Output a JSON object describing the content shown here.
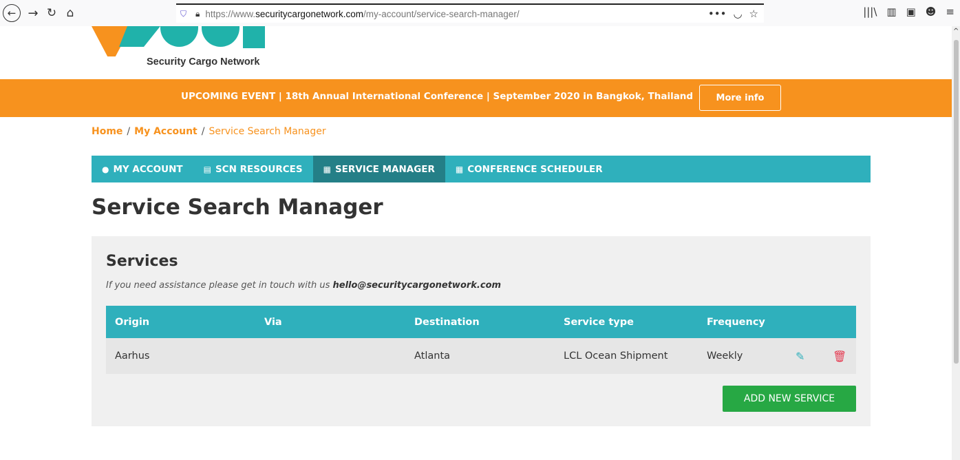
{
  "browser": {
    "url_scheme": "https://www.",
    "url_host": "securitycargonetwork.com",
    "url_path": "/my-account/service-search-manager/"
  },
  "logo": {
    "text": "Security Cargo Network"
  },
  "banner": {
    "text": "UPCOMING EVENT | 18th Annual International Conference | September 2020 in Bangkok, Thailand",
    "button": "More info"
  },
  "breadcrumb": {
    "home": "Home",
    "sep": "/",
    "account": "My Account",
    "current": "Service Search Manager"
  },
  "nav": {
    "tabs": [
      {
        "label": "MY ACCOUNT",
        "icon": "user-circle-icon"
      },
      {
        "label": "SCN RESOURCES",
        "icon": "file-icon"
      },
      {
        "label": "SERVICE MANAGER",
        "icon": "keyboard-icon"
      },
      {
        "label": "CONFERENCE SCHEDULER",
        "icon": "calendar-icon"
      }
    ]
  },
  "page": {
    "title": "Service Search Manager"
  },
  "services": {
    "title": "Services",
    "assist_text": "If you need assistance please get in touch with us ",
    "assist_email": "hello@securitycargonetwork.com",
    "columns": [
      "Origin",
      "Via",
      "Destination",
      "Service type",
      "Frequency"
    ],
    "rows": [
      {
        "origin": "Aarhus",
        "via": "",
        "destination": "Atlanta",
        "type": "LCL Ocean Shipment",
        "frequency": "Weekly"
      }
    ],
    "add_button": "ADD NEW SERVICE"
  },
  "colors": {
    "orange": "#f7921e",
    "teal": "#2fb0bc",
    "teal_dark": "#247f87",
    "green": "#27a844",
    "red": "#e53950"
  }
}
